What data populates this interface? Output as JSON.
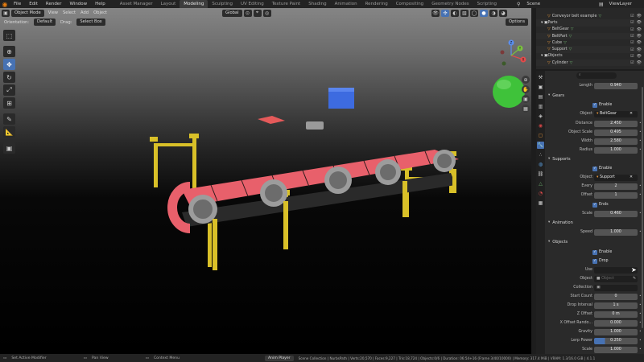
{
  "topbar": {
    "menus": [
      "File",
      "Edit",
      "Render",
      "Window",
      "Help"
    ],
    "workspaces": [
      "Asset Manager",
      "Layout",
      "Modeling",
      "Sculpting",
      "UV Editing",
      "Texture Paint",
      "Shading",
      "Animation",
      "Rendering",
      "Compositing",
      "Geometry Nodes",
      "Scripting"
    ],
    "active_workspace": "Modeling",
    "scene_label": "Scene",
    "view_layer_label": "ViewLayer"
  },
  "viewport_header": {
    "mode": "Object Mode",
    "menus": [
      "View",
      "Select",
      "Add",
      "Object"
    ],
    "transform_orientation": "Global",
    "options_label": "Options"
  },
  "tool_header": {
    "orientation_label": "Orientation:",
    "orientation_value": "Default",
    "drag_label": "Drag:",
    "drag_value": "Select Box"
  },
  "toolbar": {
    "tools": [
      "select-box-icon",
      "cursor-icon",
      "move-icon",
      "rotate-icon",
      "scale-icon",
      "transform-icon",
      "annotate-icon",
      "measure-icon",
      "add-cube-icon"
    ],
    "active_index": 2
  },
  "gizmo": {
    "x_label": "X",
    "y_label": "Y",
    "z_label": "Z"
  },
  "outliner": {
    "rows": [
      {
        "label": "Conveyor belt example",
        "indent": 1,
        "type": "object"
      },
      {
        "label": "Parts",
        "indent": 0,
        "type": "collection"
      },
      {
        "label": "BeltGear",
        "indent": 1,
        "type": "object"
      },
      {
        "label": "BeltPart",
        "indent": 1,
        "type": "object"
      },
      {
        "label": "Cube",
        "indent": 1,
        "type": "object"
      },
      {
        "label": "Support",
        "indent": 1,
        "type": "object"
      },
      {
        "label": "Objects",
        "indent": 0,
        "type": "collection"
      },
      {
        "label": "Cylinder",
        "indent": 1,
        "type": "object"
      }
    ]
  },
  "properties": {
    "search_placeholder": "",
    "length": {
      "label": "Length",
      "value": "0.940"
    },
    "gears": {
      "title": "Gears",
      "enable_label": "Enable",
      "object_label": "Object",
      "object_value": "BeltGear",
      "fields": [
        {
          "label": "Distance",
          "value": "2.450"
        },
        {
          "label": "Object Scale",
          "value": "0.495"
        },
        {
          "label": "Width",
          "value": "2.580"
        },
        {
          "label": "Radius",
          "value": "1.000"
        }
      ]
    },
    "supports": {
      "title": "Supports",
      "enable_label": "Enable",
      "object_label": "Object",
      "object_value": "Support",
      "every": {
        "label": "Every",
        "value": "2"
      },
      "offset": {
        "label": "Offset",
        "value": "1"
      },
      "ends_label": "Ends",
      "scale": {
        "label": "Scale",
        "value": "0.460"
      }
    },
    "animation": {
      "title": "Animation",
      "speed": {
        "label": "Speed",
        "value": "1.000"
      }
    },
    "objects": {
      "title": "Objects",
      "enable_label": "Enable",
      "drop_label": "Drop",
      "use_label": "Use",
      "object_label": "Object",
      "object_value": "Object",
      "collection_label": "Collection",
      "fields": [
        {
          "label": "Start Count",
          "value": "0"
        },
        {
          "label": "Drop Interval",
          "value": "1 s"
        },
        {
          "label": "Z Offset",
          "value": "0 m"
        },
        {
          "label": "X Offset Rando...",
          "value": "0.000"
        },
        {
          "label": "Gravity",
          "value": "1.000"
        },
        {
          "label": "Lerp Power",
          "value": "0.250",
          "fill": 0.25
        },
        {
          "label": "Scale",
          "value": "1.000"
        }
      ]
    }
  },
  "statusbar": {
    "left": "Set Active Modifier",
    "pan": "Pan View",
    "context": "Context Menu",
    "player": "Anim Player",
    "stats": "Scene Collection | NurbsPath | Verts:20,570 | Faces:9,227 | Tris:18,724 | Objects:0/6 | Duration: 06:54+16 (Frame 3/40/10000) | Memory: 317.4 MiB | VRAM: 1.3/16.0 GiB | 4.1.1"
  },
  "colors": {
    "accent": "#4772b3",
    "belt_pink": "#e8606b",
    "support_yellow": "#d9c028",
    "sphere_green": "#3fc23a",
    "cube_blue": "#3d6be0"
  }
}
